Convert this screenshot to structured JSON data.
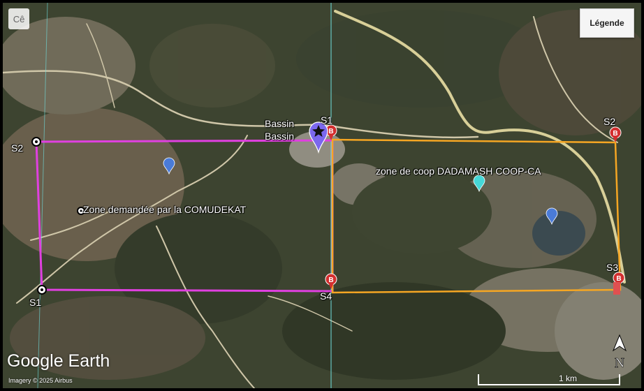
{
  "ui": {
    "legend_button": "Légende",
    "brand": "Google Earth",
    "copyright": "Imagery © 2025 Airbus",
    "scale": "1 km",
    "compass_letter": "N",
    "nav_corner": "Cê"
  },
  "labels": {
    "zone_comudekat": "Zone demandée par la COMUDEKAT",
    "zone_coop": "zone de coop DADAMASH COOP-CA",
    "bassin_1": "Bassin",
    "bassin_2": "Bassin",
    "pink_s1": "S1",
    "pink_s2": "S2",
    "orange_s1": "S1",
    "orange_s2": "S2",
    "orange_s3": "S3",
    "orange_s4": "S4",
    "pin_b": "B"
  },
  "colors": {
    "zone_comudekat_outline": "#e040e0",
    "zone_coop_outline": "#f5a623",
    "marker_red": "#d32f2f",
    "marker_blue": "#4a7bd8",
    "marker_cyan": "#45d8d8",
    "marker_purple": "#7b68ee"
  },
  "icons": [
    "circle-point-icon",
    "red-b-pin-icon",
    "blue-pin-icon",
    "cyan-pin-icon",
    "purple-star-pin-icon",
    "compass-icon"
  ]
}
